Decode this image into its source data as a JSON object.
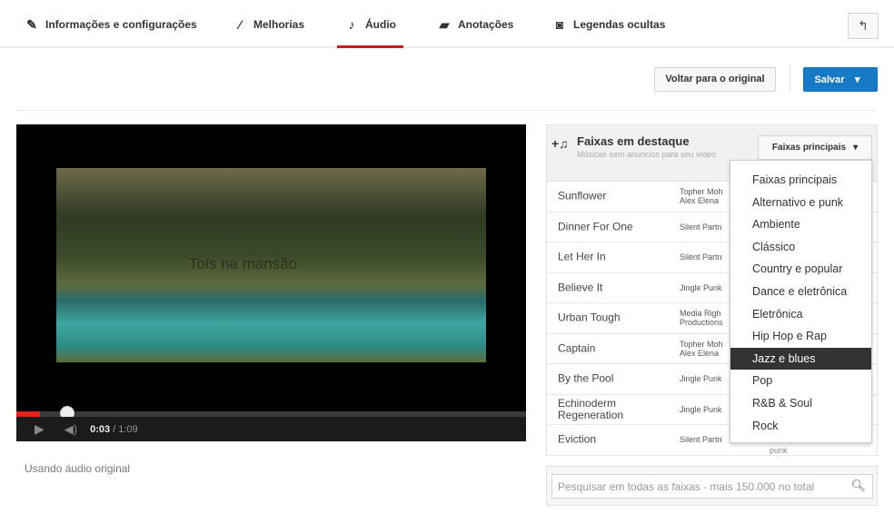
{
  "tabs": [
    {
      "label": "Informações e configurações",
      "icon": "pencil-icon"
    },
    {
      "label": "Melhorias",
      "icon": "magic-wand-icon"
    },
    {
      "label": "Áudio",
      "icon": "music-note-icon",
      "active": true
    },
    {
      "label": "Anotações",
      "icon": "speech-bubble-icon"
    },
    {
      "label": "Legendas ocultas",
      "icon": "cc-icon"
    }
  ],
  "toolbar": {
    "revert_label": "Voltar para o original",
    "save_label": "Salvar",
    "back_icon": "undo-icon",
    "accent": "#167ac6"
  },
  "video": {
    "caption": "Tois na mansão",
    "current_time": "0:03",
    "total_time": "/ 1:09",
    "progress": 0.046
  },
  "status": "Usando áudio original",
  "panel": {
    "title": "Faixas em destaque",
    "subtitle": "Músicas sem anúncios para seu vídeo",
    "dropdown_label": "Faixas principais",
    "tracks": [
      {
        "name": "Sunflower",
        "artist": "Topher Moh\nAlex Elena"
      },
      {
        "name": "Dinner For One",
        "artist": "Silent Partn"
      },
      {
        "name": "Let Her In",
        "artist": "Silent Partn"
      },
      {
        "name": "Believe It",
        "artist": "Jingle Punk"
      },
      {
        "name": "Urban Tough",
        "artist": "Media Righ\nProductions"
      },
      {
        "name": "Captain",
        "artist": "Topher Moh\nAlex Elena"
      },
      {
        "name": "By the Pool",
        "artist": "Jingle Punk"
      },
      {
        "name": "Echinoderm Regeneration",
        "artist": "Jingle Punk"
      },
      {
        "name": "Eviction",
        "artist": "Silent Partn",
        "genre": "punk"
      }
    ]
  },
  "menu": {
    "items": [
      "Faixas principais",
      "Alternativo e punk",
      "Ambiente",
      "Clássico",
      "Country e popular",
      "Dance e eletrônica",
      "Eletrônica",
      "Hip Hop e Rap",
      "Jazz e blues",
      "Pop",
      "R&B & Soul",
      "Rock"
    ],
    "highlighted": "Jazz e blues"
  },
  "search": {
    "placeholder": "Pesquisar em todas as faixas - mais 150.000 no total"
  }
}
